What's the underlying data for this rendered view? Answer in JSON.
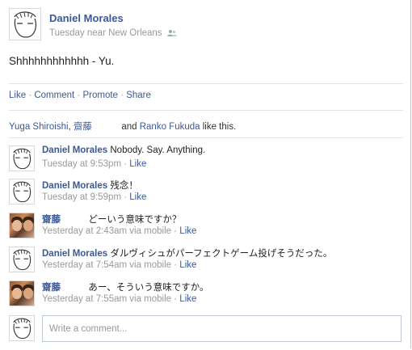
{
  "post": {
    "author": "Daniel Morales",
    "meta": "Tuesday near New Orleans",
    "text": "Shhhhhhhhhhhh - Yu."
  },
  "actions": {
    "like": "Like",
    "comment": "Comment",
    "promote": "Promote",
    "share": "Share",
    "separator": "·"
  },
  "likes": {
    "person1": "Yuga Shiroishi",
    "comma": ",",
    "person2": "齋藤",
    "and": "and",
    "person3": "Ranko Fukuda",
    "suffix": "like this."
  },
  "comments": [
    {
      "author": "Daniel Morales",
      "text": "Nobody. Say. Anything.",
      "time": "Tuesday at 9:53pm",
      "via": "",
      "like": "Like",
      "avatar": "sketch-avatar"
    },
    {
      "author": "Daniel Morales",
      "text": "残念！",
      "time": "Tuesday at 9:59pm",
      "via": "",
      "like": "Like",
      "avatar": "sketch-avatar"
    },
    {
      "author": "齋藤",
      "text": "どーいう意味ですか？",
      "time": "Yesterday at 2:43am",
      "via": "via mobile",
      "like": "Like",
      "avatar": "photo-avatar"
    },
    {
      "author": "Daniel Morales",
      "text": "ダルヴィシュがパーフェクトゲーム投げそうだった。",
      "time": "Yesterday at 7:54am",
      "via": "via mobile",
      "like": "Like",
      "avatar": "sketch-avatar"
    },
    {
      "author": "齋藤",
      "text": "あー、そういう意味ですか。",
      "time": "Yesterday at 7:55am",
      "via": "via mobile",
      "like": "Like",
      "avatar": "photo-avatar"
    }
  ],
  "write_comment": {
    "placeholder": "Write a comment..."
  },
  "colors": {
    "link": "#3b5998",
    "meta": "#999999",
    "border": "#e5e5e5"
  }
}
